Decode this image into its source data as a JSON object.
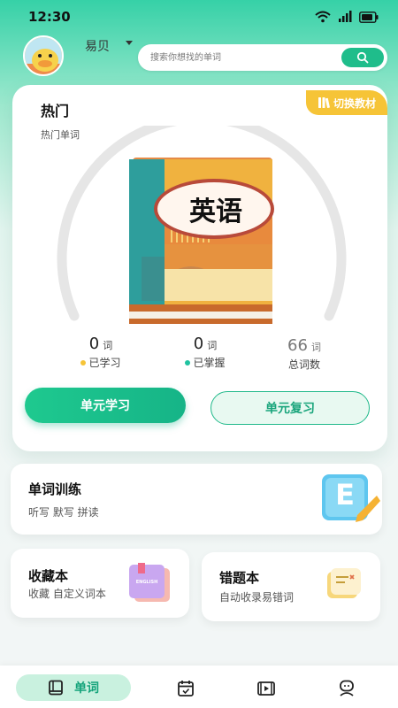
{
  "status": {
    "time": "12:30"
  },
  "user": {
    "name": "易贝"
  },
  "search": {
    "placeholder": "搜索你想找的单词"
  },
  "main_card": {
    "title": "热门",
    "subtitle": "热门单词",
    "switch_label": "切换教材",
    "book_title": "英语",
    "stats": [
      {
        "value": "0",
        "unit": "词",
        "label": "已学习",
        "dot_color": "#f6c437"
      },
      {
        "value": "0",
        "unit": "词",
        "label": "已掌握",
        "dot_color": "#20c2a0"
      },
      {
        "value": "66",
        "unit": "词",
        "label": "总词数"
      }
    ],
    "learn_button": "单元学习",
    "review_button": "单元复习"
  },
  "training": {
    "title": "单词训练",
    "subtitle": "听写 默写 拼读",
    "icon_letter": "E"
  },
  "favorites": {
    "title": "收藏本",
    "subtitle": "收藏 自定义词本",
    "icon_text": "ENGLISH"
  },
  "errors": {
    "title": "错题本",
    "subtitle": "自动收录易错词"
  },
  "tabbar": {
    "active_label": "单词"
  },
  "colors": {
    "accent": "#1ec98f",
    "yellow": "#f6c437"
  }
}
